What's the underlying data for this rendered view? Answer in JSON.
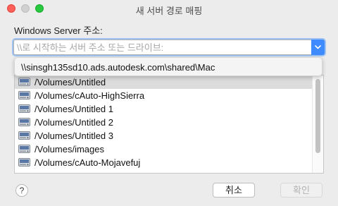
{
  "window": {
    "title": "새 서버 경로 매핑"
  },
  "form": {
    "label": "Windows Server 주소:",
    "placeholder": "\\\\로 시작하는 서버 주소 또는 드라이브:"
  },
  "suggestion": {
    "text": "\\\\sinsgh135sd10.ads.autodesk.com\\shared\\Mac"
  },
  "volumes": [
    {
      "path": "/Volumes/Untitled",
      "selected": true
    },
    {
      "path": "/Volumes/cAuto-HighSierra",
      "selected": false
    },
    {
      "path": "/Volumes/Untitled 1",
      "selected": false
    },
    {
      "path": "/Volumes/Untitled 2",
      "selected": false
    },
    {
      "path": "/Volumes/Untitled 3",
      "selected": false
    },
    {
      "path": "/Volumes/images",
      "selected": false
    },
    {
      "path": "/Volumes/cAuto-Mojavefuj",
      "selected": false
    }
  ],
  "buttons": {
    "help": "?",
    "cancel": "취소",
    "ok": "확인"
  },
  "colors": {
    "accent": "#3d8bff",
    "focus_ring": "#9ec3f2",
    "selection": "#dcdcdc"
  }
}
